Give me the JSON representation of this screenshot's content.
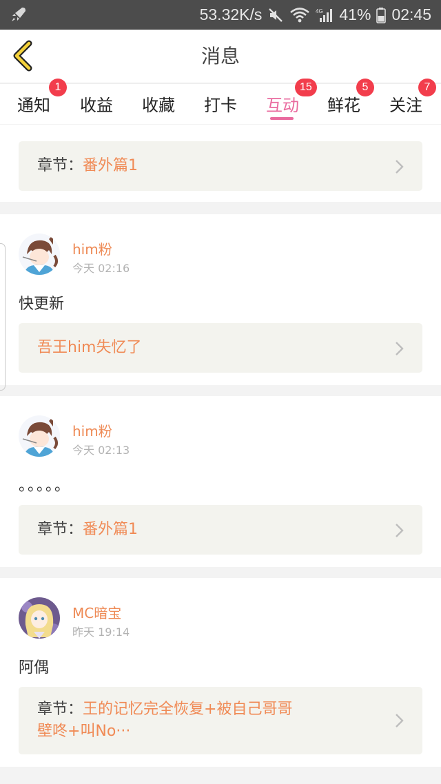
{
  "status_bar": {
    "speed": "53.32K/s",
    "battery": "41%",
    "time": "02:45",
    "icons": [
      "rocket-icon",
      "mute-icon",
      "wifi-icon",
      "signal-4g-icon",
      "battery-icon"
    ]
  },
  "header": {
    "title": "消息",
    "back_icon": "chevron-left-icon"
  },
  "tabs": [
    {
      "label": "通知",
      "badge": "1",
      "active": false
    },
    {
      "label": "收益",
      "badge": "",
      "active": false
    },
    {
      "label": "收藏",
      "badge": "",
      "active": false
    },
    {
      "label": "打卡",
      "badge": "",
      "active": false
    },
    {
      "label": "互动",
      "badge": "15",
      "active": true
    },
    {
      "label": "鲜花",
      "badge": "5",
      "active": false
    },
    {
      "label": "关注",
      "badge": "7",
      "active": false
    }
  ],
  "top_card": {
    "prefix": "章节：",
    "link": "番外篇1"
  },
  "messages": [
    {
      "user": "him粉",
      "time": "今天 02:16",
      "text": "快更新",
      "ref_prefix": "",
      "ref_link": "吾王him失忆了"
    },
    {
      "user": "him粉",
      "time": "今天 02:13",
      "text": "。。。。。",
      "ref_prefix": "章节：",
      "ref_link": "番外篇1"
    },
    {
      "user": "MC暗宝",
      "time": "昨天 19:14",
      "text": "阿偶",
      "ref_prefix": "章节：",
      "ref_link": "王的记忆完全恢复+被自己哥哥",
      "ref_link_2": "壁咚+叫No···"
    }
  ],
  "colors": {
    "accent_pink": "#e96a9e",
    "link_orange": "#f08a55",
    "badge_red": "#f23d4c",
    "status_bar": "#4c4c4c"
  }
}
